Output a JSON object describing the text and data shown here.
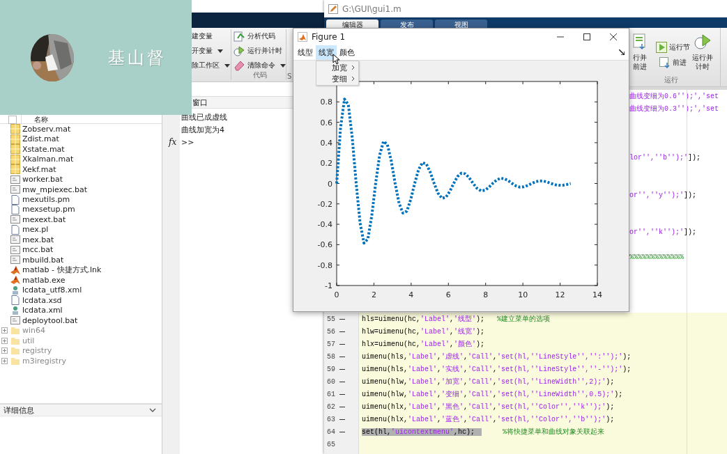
{
  "banner": {
    "title": "基山督"
  },
  "main_toolstrip": {
    "variable_items": [
      {
        "label": "建变量",
        "dropdown": false
      },
      {
        "label": "开变量",
        "dropdown": true
      },
      {
        "label": "除工作区",
        "dropdown": true
      }
    ],
    "code_items": [
      {
        "label": "分析代码",
        "dropdown": false
      },
      {
        "label": "运行并计时",
        "dropdown": false
      },
      {
        "label": "清除命令",
        "dropdown": true
      }
    ],
    "code_section": "代码",
    "next_section": "S"
  },
  "file_browser": {
    "header_checked": false,
    "header": "名称",
    "items": [
      {
        "name": "Zobserv.mat",
        "kind": "mat"
      },
      {
        "name": "Zdist.mat",
        "kind": "mat"
      },
      {
        "name": "Xstate.mat",
        "kind": "mat"
      },
      {
        "name": "Xkalman.mat",
        "kind": "mat"
      },
      {
        "name": "Xekf.mat",
        "kind": "mat"
      },
      {
        "name": "worker.bat",
        "kind": "bat"
      },
      {
        "name": "mw_mpiexec.bat",
        "kind": "bat"
      },
      {
        "name": "mexutils.pm",
        "kind": "file"
      },
      {
        "name": "mexsetup.pm",
        "kind": "file"
      },
      {
        "name": "mexext.bat",
        "kind": "bat"
      },
      {
        "name": "mex.pl",
        "kind": "file"
      },
      {
        "name": "mex.bat",
        "kind": "bat"
      },
      {
        "name": "mcc.bat",
        "kind": "bat"
      },
      {
        "name": "mbuild.bat",
        "kind": "bat"
      },
      {
        "name": "matlab - 快捷方式.lnk",
        "kind": "matlab"
      },
      {
        "name": "matlab.exe",
        "kind": "matlab"
      },
      {
        "name": "lcdata_utf8.xml",
        "kind": "xml"
      },
      {
        "name": "lcdata.xsd",
        "kind": "file"
      },
      {
        "name": "lcdata.xml",
        "kind": "xml"
      },
      {
        "name": "deploytool.bat",
        "kind": "bat"
      },
      {
        "name": "win64",
        "kind": "folder"
      },
      {
        "name": "util",
        "kind": "folder"
      },
      {
        "name": "registry",
        "kind": "folder"
      },
      {
        "name": "m3iregistry",
        "kind": "folder"
      }
    ],
    "details_label": "详细信息"
  },
  "command_window": {
    "title": "窗口",
    "lines": [
      "曲线已成虚线",
      "曲线加宽为4"
    ],
    "fx": "fx",
    "prompt": ">>"
  },
  "editor": {
    "title": "G:\\GUI\\gui1.m",
    "tabs": [
      {
        "label": "编辑器",
        "selected": true
      },
      {
        "label": "发布",
        "selected": false
      },
      {
        "label": "视图",
        "selected": false
      }
    ],
    "run_buttons": [
      {
        "label": "行并前进",
        "kind": "big"
      },
      {
        "label": "运行节",
        "kind": "small"
      },
      {
        "label": "前进",
        "kind": "small"
      },
      {
        "label": "运行并计时",
        "kind": "big"
      }
    ],
    "run_section": "运行",
    "partial_lines": [
      {
        "kind": "text",
        "segments": [
          {
            "kind": "str",
            "t": "曲线变细为0.6'');','set"
          }
        ]
      },
      {
        "kind": "text",
        "segments": [
          {
            "kind": "str",
            "t": "曲线变细为0.3'');','set"
          }
        ]
      },
      {
        "kind": "blank"
      },
      {
        "kind": "blank"
      },
      {
        "kind": "blank"
      },
      {
        "kind": "text",
        "segments": [
          {
            "kind": "str",
            "t": "lor'',''b'');'"
          },
          {
            "kind": "code",
            "t": "]);"
          }
        ]
      },
      {
        "kind": "blank"
      },
      {
        "kind": "blank"
      },
      {
        "kind": "text",
        "segments": [
          {
            "kind": "str",
            "t": "or'',''y'');'"
          },
          {
            "kind": "code",
            "t": "]);"
          }
        ]
      },
      {
        "kind": "blank"
      },
      {
        "kind": "blank"
      },
      {
        "kind": "text",
        "segments": [
          {
            "kind": "str",
            "t": "or'',''k'');'"
          },
          {
            "kind": "code",
            "t": "]);"
          }
        ]
      },
      {
        "kind": "blank"
      },
      {
        "kind": "text",
        "segments": [
          {
            "kind": "comment",
            "t": "%%%%%%%%%%%%%"
          }
        ]
      },
      {
        "kind": "blank"
      },
      {
        "kind": "blank"
      },
      {
        "kind": "blank"
      },
      {
        "kind": "blank"
      }
    ],
    "lines": [
      {
        "number": "55",
        "executable": true,
        "highlighted": false,
        "segments": [
          {
            "kind": "code",
            "t": "hls=uimenu(hc,"
          },
          {
            "kind": "str",
            "t": "'Label'"
          },
          {
            "kind": "code",
            "t": ","
          },
          {
            "kind": "str",
            "t": "'线型'"
          },
          {
            "kind": "code",
            "t": ");   "
          },
          {
            "kind": "comment",
            "t": "%建立菜单的选项"
          }
        ]
      },
      {
        "number": "56",
        "executable": true,
        "highlighted": false,
        "segments": [
          {
            "kind": "code",
            "t": "hlw=uimenu(hc,"
          },
          {
            "kind": "str",
            "t": "'Label'"
          },
          {
            "kind": "code",
            "t": ","
          },
          {
            "kind": "str",
            "t": "'线宽'"
          },
          {
            "kind": "code",
            "t": ");"
          }
        ]
      },
      {
        "number": "57",
        "executable": true,
        "highlighted": false,
        "segments": [
          {
            "kind": "code",
            "t": "hlx=uimenu(hc,"
          },
          {
            "kind": "str",
            "t": "'Label'"
          },
          {
            "kind": "code",
            "t": ","
          },
          {
            "kind": "str",
            "t": "'颜色'"
          },
          {
            "kind": "code",
            "t": ");"
          }
        ]
      },
      {
        "number": "58",
        "executable": true,
        "highlighted": false,
        "segments": [
          {
            "kind": "code",
            "t": "uimenu(hls,"
          },
          {
            "kind": "str",
            "t": "'Label'"
          },
          {
            "kind": "code",
            "t": ","
          },
          {
            "kind": "str",
            "t": "'虚线'"
          },
          {
            "kind": "code",
            "t": ","
          },
          {
            "kind": "str",
            "t": "'Call'"
          },
          {
            "kind": "code",
            "t": ","
          },
          {
            "kind": "str",
            "t": "'set(hl,''LineStyle'','':'');'"
          },
          {
            "kind": "code",
            "t": ");"
          }
        ]
      },
      {
        "number": "59",
        "executable": true,
        "highlighted": false,
        "segments": [
          {
            "kind": "code",
            "t": "uimenu(hls,"
          },
          {
            "kind": "str",
            "t": "'Label'"
          },
          {
            "kind": "code",
            "t": ","
          },
          {
            "kind": "str",
            "t": "'实线'"
          },
          {
            "kind": "code",
            "t": ","
          },
          {
            "kind": "str",
            "t": "'Call'"
          },
          {
            "kind": "code",
            "t": ","
          },
          {
            "kind": "str",
            "t": "'set(hl,''LineStyle'',''-'');'"
          },
          {
            "kind": "code",
            "t": ");"
          }
        ]
      },
      {
        "number": "60",
        "executable": true,
        "highlighted": false,
        "segments": [
          {
            "kind": "code",
            "t": "uimenu(hlw,"
          },
          {
            "kind": "str",
            "t": "'Label'"
          },
          {
            "kind": "code",
            "t": ","
          },
          {
            "kind": "str",
            "t": "'加宽'"
          },
          {
            "kind": "code",
            "t": ","
          },
          {
            "kind": "str",
            "t": "'Call'"
          },
          {
            "kind": "code",
            "t": ","
          },
          {
            "kind": "str",
            "t": "'set(hl,''LineWidth'',2);'"
          },
          {
            "kind": "code",
            "t": ");"
          }
        ]
      },
      {
        "number": "61",
        "executable": true,
        "highlighted": false,
        "segments": [
          {
            "kind": "code",
            "t": "uimenu(hlw,"
          },
          {
            "kind": "str",
            "t": "'Label'"
          },
          {
            "kind": "code",
            "t": ","
          },
          {
            "kind": "str",
            "t": "'变细'"
          },
          {
            "kind": "code",
            "t": ","
          },
          {
            "kind": "str",
            "t": "'Call'"
          },
          {
            "kind": "code",
            "t": ","
          },
          {
            "kind": "str",
            "t": "'set(hl,''LineWidth'',0.5);'"
          },
          {
            "kind": "code",
            "t": ");"
          }
        ]
      },
      {
        "number": "62",
        "executable": true,
        "highlighted": false,
        "segments": [
          {
            "kind": "code",
            "t": "uimenu(hlx,"
          },
          {
            "kind": "str",
            "t": "'Label'"
          },
          {
            "kind": "code",
            "t": ","
          },
          {
            "kind": "str",
            "t": "'黑色'"
          },
          {
            "kind": "code",
            "t": ","
          },
          {
            "kind": "str",
            "t": "'Call'"
          },
          {
            "kind": "code",
            "t": ","
          },
          {
            "kind": "str",
            "t": "'set(hl,''Color'',''k'');'"
          },
          {
            "kind": "code",
            "t": ");"
          }
        ]
      },
      {
        "number": "63",
        "executable": true,
        "highlighted": false,
        "segments": [
          {
            "kind": "code",
            "t": "uimenu(hlx,"
          },
          {
            "kind": "str",
            "t": "'Label'"
          },
          {
            "kind": "code",
            "t": ","
          },
          {
            "kind": "str",
            "t": "'蓝色'"
          },
          {
            "kind": "code",
            "t": ","
          },
          {
            "kind": "str",
            "t": "'Call'"
          },
          {
            "kind": "code",
            "t": ","
          },
          {
            "kind": "str",
            "t": "'set(hl,''Color'',''b'');'"
          },
          {
            "kind": "code",
            "t": ");"
          }
        ]
      },
      {
        "number": "64",
        "executable": true,
        "highlighted": true,
        "segments": [
          {
            "kind": "code",
            "t": "set(hl,"
          },
          {
            "kind": "str",
            "t": "'uicontextmenu'"
          },
          {
            "kind": "code",
            "t": ",hc);"
          }
        ],
        "comment": "%将快捷菜单和曲线对象关联起来"
      },
      {
        "number": "65",
        "executable": false,
        "highlighted": false
      }
    ]
  },
  "figure": {
    "title": "Figure 1",
    "menus": [
      {
        "label": "线型",
        "selected": false
      },
      {
        "label": "线宽",
        "selected": true
      },
      {
        "label": "颜色",
        "selected": false
      }
    ],
    "submenu": [
      {
        "label": "加宽",
        "has_submenu": true
      },
      {
        "label": "变细",
        "has_submenu": true
      }
    ],
    "chart_data": {
      "type": "line",
      "xlim": [
        0,
        14
      ],
      "ylim": [
        -1,
        1
      ],
      "xticks": [
        0,
        2,
        4,
        6,
        8,
        10,
        12,
        14
      ],
      "yticks": [
        -1,
        -0.8,
        -0.6,
        -0.4,
        -0.2,
        0,
        0.2,
        0.4,
        0.6,
        0.8
      ],
      "x": [
        0,
        0.209,
        0.419,
        0.628,
        0.838,
        1.047,
        1.257,
        1.466,
        1.676,
        1.885,
        2.094,
        2.304,
        2.513,
        2.723,
        2.932,
        3.142,
        3.351,
        3.56,
        3.77,
        3.979,
        4.189,
        4.398,
        4.608,
        4.817,
        5.027,
        5.236,
        5.445,
        5.655,
        5.864,
        6.074,
        6.283,
        6.493,
        6.702,
        6.912,
        7.121,
        7.33,
        7.54,
        7.749,
        7.959,
        8.168,
        8.378,
        8.587,
        8.796,
        9.006,
        9.215,
        9.425,
        9.634,
        9.844,
        10.053,
        10.263,
        10.472,
        10.681,
        10.891,
        11.1,
        11.31,
        11.519,
        11.729,
        11.938,
        12.147,
        12.357,
        12.566
      ],
      "series": [
        {
          "color": "#0072bd",
          "line_style": "dotted",
          "values": [
            0,
            0.548,
            0.827,
            0.771,
            0.445,
            0,
            -0.387,
            -0.584,
            -0.544,
            -0.314,
            0,
            0.273,
            0.412,
            0.384,
            0.221,
            0,
            -0.193,
            -0.29,
            -0.271,
            -0.156,
            0,
            0.136,
            0.205,
            0.191,
            0.11,
            0,
            -0.096,
            -0.145,
            -0.135,
            -0.078,
            0,
            0.068,
            0.102,
            0.095,
            0.055,
            0,
            -0.048,
            -0.072,
            -0.067,
            -0.039,
            0,
            0.034,
            0.051,
            0.047,
            0.027,
            0,
            -0.024,
            -0.036,
            -0.033,
            -0.019,
            0,
            0.017,
            0.025,
            0.024,
            0.014,
            0,
            -0.012,
            -0.018,
            -0.017,
            -0.01,
            0
          ]
        }
      ]
    }
  }
}
